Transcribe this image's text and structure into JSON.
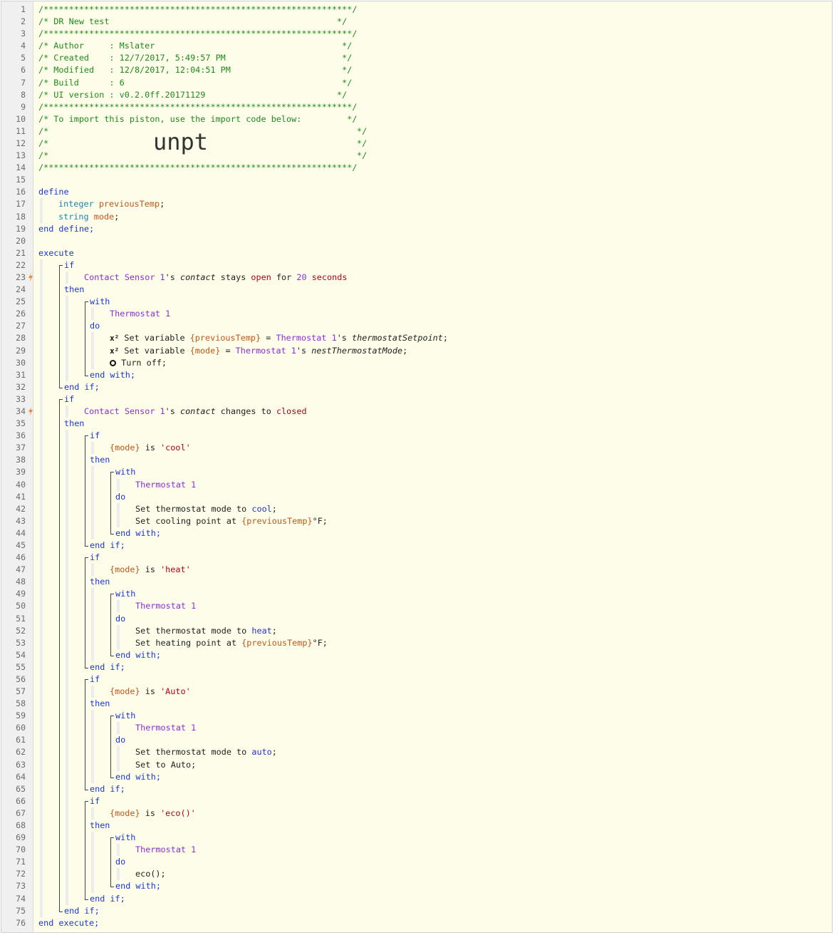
{
  "header": {
    "border": "/*************************************************************/",
    "title": "/* DR New test                                             */",
    "author": "/* Author     : Mslater                                     */",
    "created": "/* Created    : 12/7/2017, 5:49:57 PM                       */",
    "modified": "/* Modified   : 12/8/2017, 12:04:51 PM                      */",
    "build": "/* Build      : 6                                           */",
    "ui_version": "/* UI version : v0.2.0ff.20171129                          */",
    "import_note": "/* To import this piston, use the import code below:         */",
    "blank_left": "/*",
    "blank_right": "*/",
    "import_code": "unpt"
  },
  "define": {
    "open": "define",
    "vars": [
      {
        "type": "integer",
        "name": "previousTemp"
      },
      {
        "type": "string",
        "name": "mode"
      }
    ],
    "close": "end define;"
  },
  "execute": {
    "open": "execute",
    "close": "end execute;"
  },
  "kw": {
    "if": "if",
    "then": "then",
    "with": "with",
    "do": "do",
    "end_with": "end with;",
    "end_if": "end if;",
    "is": "is",
    "semicolon": ";"
  },
  "cond1": {
    "device": "Contact Sensor 1",
    "poss": "'s",
    "attr": "contact",
    "op": "stays",
    "val": "open",
    "for": "for",
    "num": "20",
    "unit": "seconds"
  },
  "block1": {
    "device": "Thermostat 1",
    "stmt1": {
      "icon": "x²",
      "pre": "Set variable",
      "var": "{previousTemp}",
      "eq": "=",
      "device": "Thermostat 1",
      "poss": "'s",
      "attr": "thermostatSetpoint",
      "end": ";"
    },
    "stmt2": {
      "icon": "x²",
      "pre": "Set variable",
      "var": "{mode}",
      "eq": "=",
      "device": "Thermostat 1",
      "poss": "'s",
      "attr": "nestThermostatMode",
      "end": ";"
    },
    "stmt3": {
      "text": "Turn off;"
    }
  },
  "cond2": {
    "device": "Contact Sensor 1",
    "poss": "'s",
    "attr": "contact",
    "op": "changes to",
    "val": "closed"
  },
  "branches": [
    {
      "var": "{mode}",
      "str": "'cool'",
      "device": "Thermostat 1",
      "s1_pre": "Set thermostat mode to",
      "s1_val": "cool",
      "s1_end": ";",
      "s2_pre": "Set cooling point at",
      "s2_var": "{previousTemp}",
      "s2_end": "°F;"
    },
    {
      "var": "{mode}",
      "str": "'heat'",
      "device": "Thermostat 1",
      "s1_pre": "Set thermostat mode to",
      "s1_val": "heat",
      "s1_end": ";",
      "s2_pre": "Set heating point at",
      "s2_var": "{previousTemp}",
      "s2_end": "°F;"
    },
    {
      "var": "{mode}",
      "str": "'Auto'",
      "device": "Thermostat 1",
      "s1_pre": "Set thermostat mode to",
      "s1_val": "auto",
      "s1_end": ";",
      "s2_text": "Set to Auto;"
    },
    {
      "var": "{mode}",
      "str": "'eco()'",
      "device": "Thermostat 1",
      "s1_text": "eco();"
    }
  ],
  "line_numbers": [
    "1",
    "2",
    "3",
    "4",
    "5",
    "6",
    "7",
    "8",
    "9",
    "10",
    "11",
    "12",
    "13",
    "14",
    "15",
    "16",
    "17",
    "18",
    "19",
    "20",
    "21",
    "22",
    "23",
    "24",
    "25",
    "26",
    "27",
    "28",
    "29",
    "30",
    "31",
    "32",
    "33",
    "34",
    "35",
    "36",
    "37",
    "38",
    "39",
    "40",
    "41",
    "42",
    "43",
    "44",
    "45",
    "46",
    "47",
    "48",
    "49",
    "50",
    "51",
    "52",
    "53",
    "54",
    "55",
    "56",
    "57",
    "58",
    "59",
    "60",
    "61",
    "62",
    "63",
    "64",
    "65",
    "66",
    "67",
    "68",
    "69",
    "70",
    "71",
    "72",
    "73",
    "74",
    "75",
    "76"
  ],
  "colors": {
    "background": "#fdfde9",
    "gutter": "#f0f0f0",
    "comment": "#1f8a1f",
    "keyword": "#1a37d6",
    "device": "#8b2fd6",
    "variable": "#c1561a",
    "value": "#b3001b",
    "trigger_bolt": "#f0883a"
  }
}
